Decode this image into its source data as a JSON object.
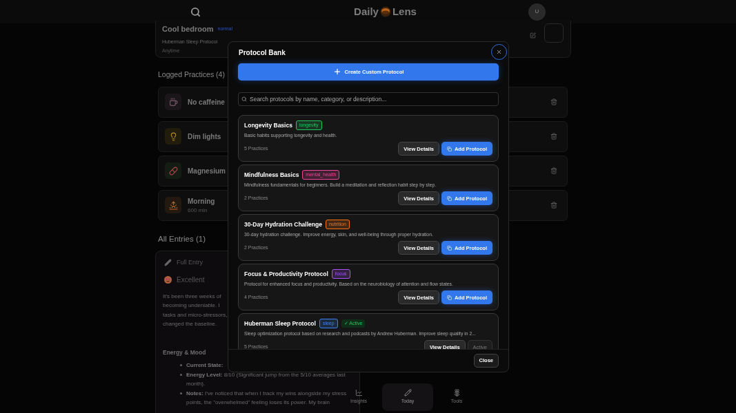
{
  "header": {
    "logo_left": "Daily",
    "logo_right": "Lens",
    "avatar": "U"
  },
  "top_card": {
    "name": "Cool bedroom",
    "tag": "normal",
    "protocol": "Huberman Sleep Protocol",
    "time": "Anytime",
    "checked": false
  },
  "logged_practices": {
    "title": "Logged Practices (4)",
    "items": [
      {
        "name": "No caffeine"
      },
      {
        "name": "Dim lights"
      },
      {
        "name": "Magnesium"
      },
      {
        "name": "Morning",
        "detail": "600 min"
      }
    ]
  },
  "all_entries": {
    "title": "All Entries (1)",
    "entry": {
      "type": "Full Entry",
      "mood": "Excellent",
      "lines": [
        "It’s been three weeks of",
        "becoming undeniable. I",
        "tasks and micro-stressors,",
        "changed the baseline."
      ],
      "section": "Energy & Mood",
      "bullets": [
        {
          "label": "Current State:"
        },
        {
          "label": "Energy Level:",
          "text": "8/10 (Significant jump from the 5/10 averages last month)."
        },
        {
          "label": "Notes:",
          "text": "I've noticed that when I track my wins alongside my stress points, the \"overwhelmed\" feeling loses its power. My brain"
        }
      ]
    }
  },
  "bottom_nav": [
    {
      "label": "Insights",
      "selected": false
    },
    {
      "label": "Today",
      "selected": true
    },
    {
      "label": "Tools",
      "selected": false
    }
  ],
  "modal": {
    "title": "Protocol Bank",
    "create_button": "Create Custom Protocol",
    "search": {
      "placeholder": "Search protocols by name, category, or description..."
    },
    "protocols": [
      {
        "name": "Longevity Basics",
        "tag": "longevity",
        "color": "#22c55e",
        "description": "Basic habits supporting longevity and health.",
        "count": "5 Practices",
        "details_button": "View Details",
        "action_button": "Add Protocol",
        "active": false
      },
      {
        "name": "Mindfulness Basics",
        "tag": "mental_health",
        "color": "#ec4899",
        "description": "Mindfulness fundamentals for beginners. Build a meditation and reflection habit step by step.",
        "count": "2 Practices",
        "details_button": "View Details",
        "action_button": "Add Protocol",
        "active": false
      },
      {
        "name": "30-Day Hydration Challenge",
        "tag": "nutrition",
        "color": "#f97316",
        "description": "30-day hydration challenge. Improve energy, skin, and well-being through proper hydration.",
        "count": "2 Practices",
        "details_button": "View Details",
        "action_button": "Add Protocol",
        "active": false
      },
      {
        "name": "Focus & Productivity Protocol",
        "tag": "focus",
        "color": "#a855f7",
        "description": "Protocol for enhanced focus and productivity. Based on the neurobiology of attention and flow states.",
        "count": "4 Practices",
        "details_button": "View Details",
        "action_button": "Add Protocol",
        "active": false
      },
      {
        "name": "Huberman Sleep Protocol",
        "tag": "sleep",
        "color": "#3b82f6",
        "status_badge": "✓ Active",
        "description": "Sleep optimization protocol based on research and podcasts by Andrew Huberman. Improve sleep quality in 2...",
        "count": "5 Practices",
        "details_button": "View Details",
        "action_button": "Active",
        "active": true
      }
    ],
    "close_button": "Close"
  }
}
